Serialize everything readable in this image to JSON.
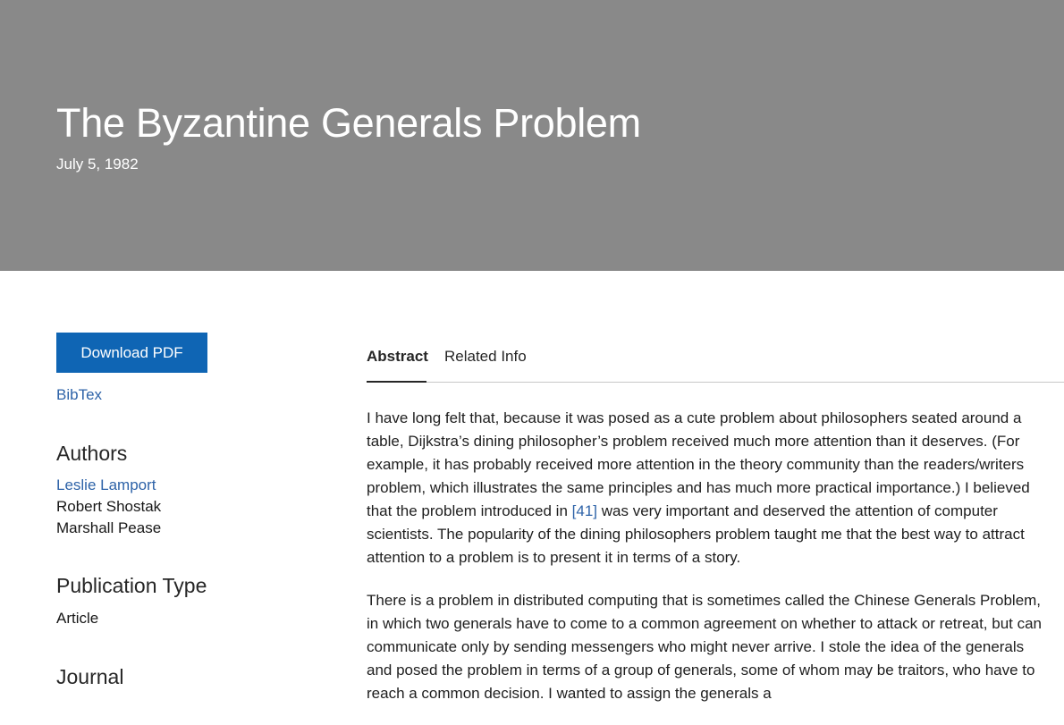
{
  "hero": {
    "title": "The Byzantine Generals Problem",
    "date": "July 5, 1982",
    "background_color": "#898989"
  },
  "sidebar": {
    "download_label": "Download PDF",
    "bibtex_label": "BibTex",
    "authors_heading": "Authors",
    "authors": [
      "Leslie Lamport",
      "Robert Shostak",
      "Marshall Pease"
    ],
    "publication_type_heading": "Publication Type",
    "publication_type": "Article",
    "journal_heading": "Journal",
    "accent_color": "#0f65b4"
  },
  "tabs": {
    "abstract": "Abstract",
    "related": "Related Info",
    "active": "Abstract"
  },
  "abstract": {
    "p1_before": "I have long felt that, because it was posed as a cute problem about philosophers seated around a table, Dijkstra’s dining philosopher’s problem received much more attention than it deserves. (For example, it has probably received more attention in the theory community than the readers/writers problem, which illustrates the same principles and has much more practical importance.) I believed that the problem introduced in ",
    "p1_ref": "[41]",
    "p1_after": " was very important and deserved the attention of computer scientists. The popularity of the dining philosophers problem taught me that the best way to attract attention to a problem is to present it in terms of a story.",
    "p2": "There is a problem in distributed computing that is sometimes called the Chinese Generals Problem, in which two generals have to come to a common agreement on whether to attack or retreat, but can communicate only by sending messengers who might never arrive. I stole the idea of the generals and posed the problem in terms of a group of generals, some of whom may be traitors, who have to reach a common decision. I wanted to assign the generals a"
  }
}
